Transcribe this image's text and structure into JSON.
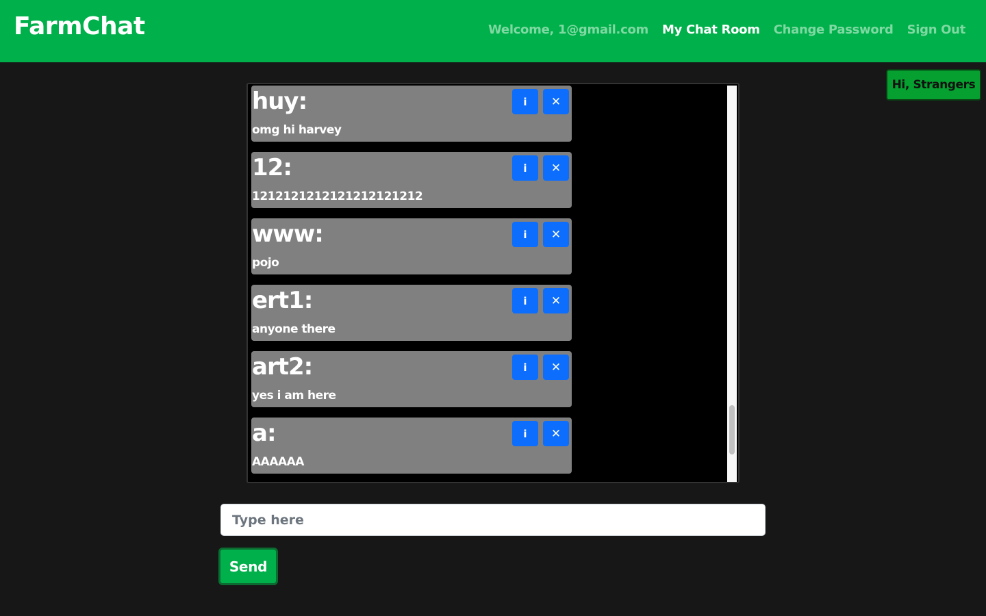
{
  "nav": {
    "brand": "FarmChat",
    "welcome": "Welcome, 1@gmail.com",
    "my_chat_room": "My Chat Room",
    "change_password": "Change Password",
    "sign_out": "Sign Out"
  },
  "badge": "Hi, Strangers",
  "messages": [
    {
      "user": "huy:",
      "text": "omg hi harvey",
      "info_label": "i",
      "delete_label": "✕"
    },
    {
      "user": "12:",
      "text": "1212121212121212121212",
      "info_label": "i",
      "delete_label": "✕"
    },
    {
      "user": "www:",
      "text": "pojo",
      "info_label": "i",
      "delete_label": "✕"
    },
    {
      "user": "ert1:",
      "text": "anyone there",
      "info_label": "i",
      "delete_label": "✕"
    },
    {
      "user": "art2:",
      "text": "yes i am here",
      "info_label": "i",
      "delete_label": "✕"
    },
    {
      "user": "a:",
      "text": "AAAAAA",
      "info_label": "i",
      "delete_label": "✕"
    }
  ],
  "composer": {
    "placeholder": "Type here",
    "value": "",
    "send_label": "Send"
  },
  "colors": {
    "navbar": "#00b04a",
    "background": "#171717",
    "message_bg": "#808080",
    "button_blue": "#0d6efd"
  }
}
